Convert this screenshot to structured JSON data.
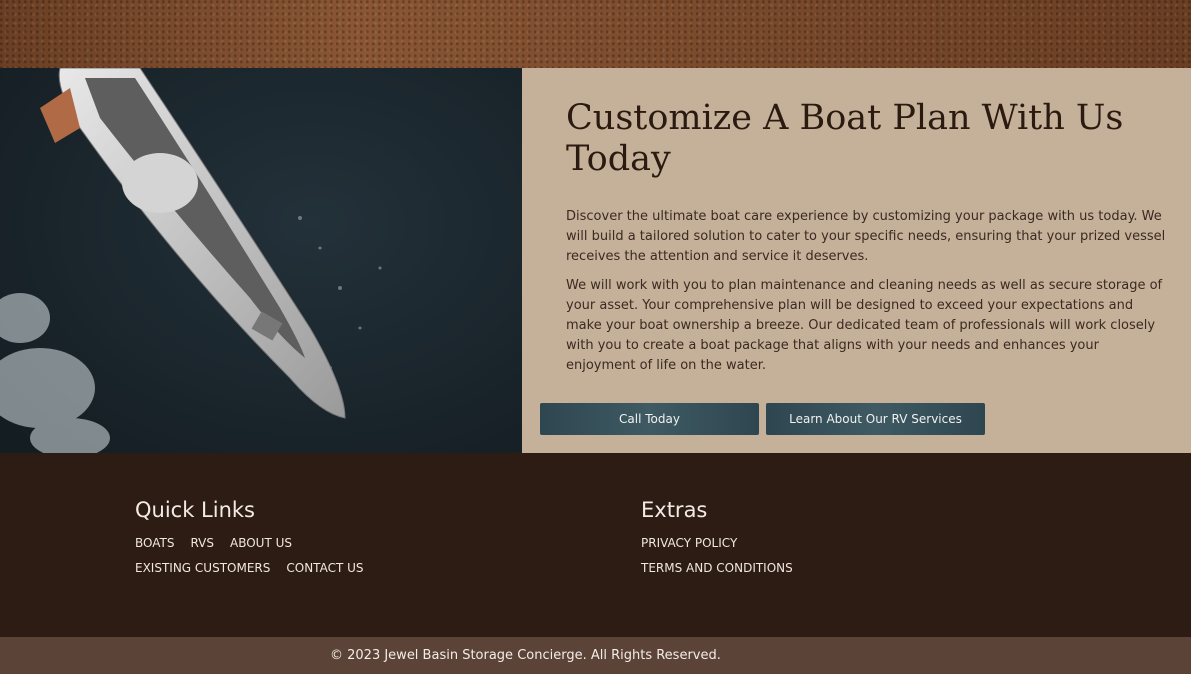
{
  "hero": {
    "title": "Customize A Boat Plan With Us Today",
    "paragraph1": "Discover the ultimate boat care experience by customizing your package with us today. We will build a tailored solution to cater to your specific needs, ensuring that your prized vessel receives the attention and service it deserves.",
    "paragraph2": "We will work with you to plan maintenance and cleaning needs as well as secure storage of your asset. Your comprehensive plan will be designed to exceed your expectations and make your boat ownership a breeze. Our dedicated team of professionals will work closely with you to create a boat package that aligns with your needs and enhances your enjoyment of life on the water.",
    "button_call": "Call Today",
    "button_rv": "Learn About Our RV Services"
  },
  "footer": {
    "quick_links_title": "Quick Links",
    "quick_links": [
      "BOATS",
      "RVS",
      "ABOUT US",
      "EXISTING CUSTOMERS",
      "CONTACT US"
    ],
    "extras_title": "Extras",
    "extras": [
      "PRIVACY POLICY",
      "TERMS AND CONDITIONS"
    ],
    "copyright": "© 2023 Jewel Basin Storage Concierge. All Rights Reserved."
  },
  "colors": {
    "panel": "#c5b09a",
    "footer": "#2d1c13",
    "button": "#3a525a",
    "copyright_bar": "#5b4338"
  }
}
